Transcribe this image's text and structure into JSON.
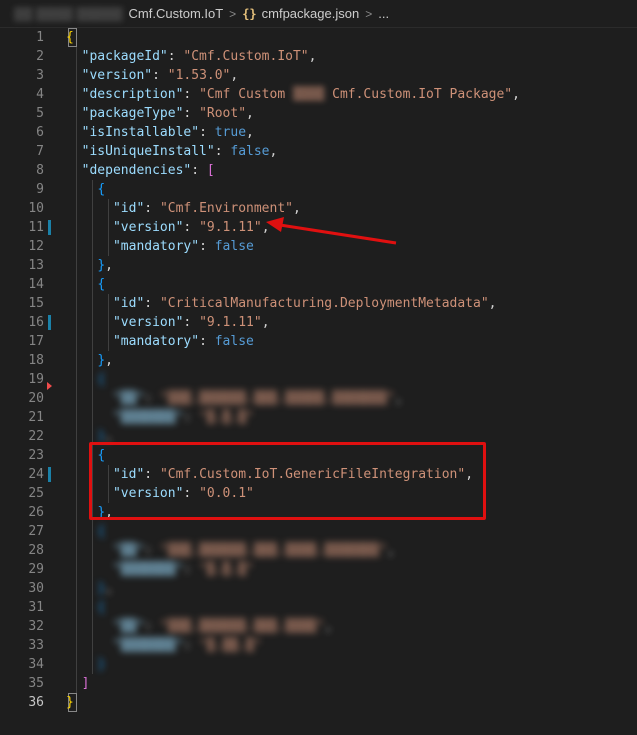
{
  "breadcrumb": {
    "root_blurred": "▒▒ ▒▒▒▒ ▒▒▒▒▒",
    "folder": "Cmf.Custom.IoT",
    "file_icon": "{}",
    "file": "cmfpackage.json",
    "more": "..."
  },
  "line_numbers": [
    "1",
    "2",
    "3",
    "4",
    "5",
    "6",
    "7",
    "8",
    "9",
    "10",
    "11",
    "12",
    "13",
    "14",
    "15",
    "16",
    "17",
    "18",
    "19",
    "20",
    "21",
    "22",
    "23",
    "24",
    "25",
    "26",
    "27",
    "28",
    "29",
    "30",
    "31",
    "32",
    "33",
    "34",
    "35",
    "36"
  ],
  "code": {
    "packageId_key": "\"packageId\"",
    "packageId_val": "\"Cmf.Custom.IoT\"",
    "version_key": "\"version\"",
    "version_val": "\"1.53.0\"",
    "description_key": "\"description\"",
    "description_val_a": "\"Cmf Custom ",
    "description_blur": "▒▒▒▒",
    "description_val_b": " Cmf.Custom.IoT Package\"",
    "packageType_key": "\"packageType\"",
    "packageType_val": "\"Root\"",
    "isInstallable_key": "\"isInstallable\"",
    "isInstallable_val": "true",
    "isUniqueInstall_key": "\"isUniqueInstall\"",
    "isUniqueInstall_val": "false",
    "dependencies_key": "\"dependencies\"",
    "id_key": "\"id\"",
    "version_key2": "\"version\"",
    "mandatory_key": "\"mandatory\"",
    "dep1_id": "\"Cmf.Environment\"",
    "dep1_version": "\"9.1.11\"",
    "dep1_mandatory": "false",
    "dep2_id": "\"CriticalManufacturing.DeploymentMetadata\"",
    "dep2_version": "\"9.1.11\"",
    "dep2_mandatory": "false",
    "dep3_id_blur": "\"▒▒▒.▒▒▒▒▒▒.▒▒▒.▒▒▒▒▒.▒▒▒▒▒▒▒\"",
    "dep3_version_blur": "\"▒.▒.▒\"",
    "dep4_id": "\"Cmf.Custom.IoT.GenericFileIntegration\"",
    "dep4_version": "\"0.0.1\"",
    "dep5_id_blur": "\"▒▒▒.▒▒▒▒▒▒.▒▒▒.▒▒▒▒.▒▒▒▒▒▒▒\"",
    "dep5_version_blur": "\"▒.▒.▒\"",
    "dep6_id_blur": "\"▒▒▒.▒▒▒▒▒▒.▒▒▒.▒▒▒▒\"",
    "dep6_version_blur": "\"▒.▒▒.▒\"",
    "key_blur": "\"▒▒\"",
    "key2_blur": "\"▒▒▒▒▒▒▒\""
  },
  "colors": {
    "background": "#1e1e1e",
    "key": "#9cdcfe",
    "string": "#ce9178",
    "boolean": "#569cd6",
    "highlight_box": "#e01010",
    "arrow": "#e01010"
  },
  "icons": [
    "chevron-right-icon",
    "json-file-icon",
    "red-arrow-annotation"
  ]
}
